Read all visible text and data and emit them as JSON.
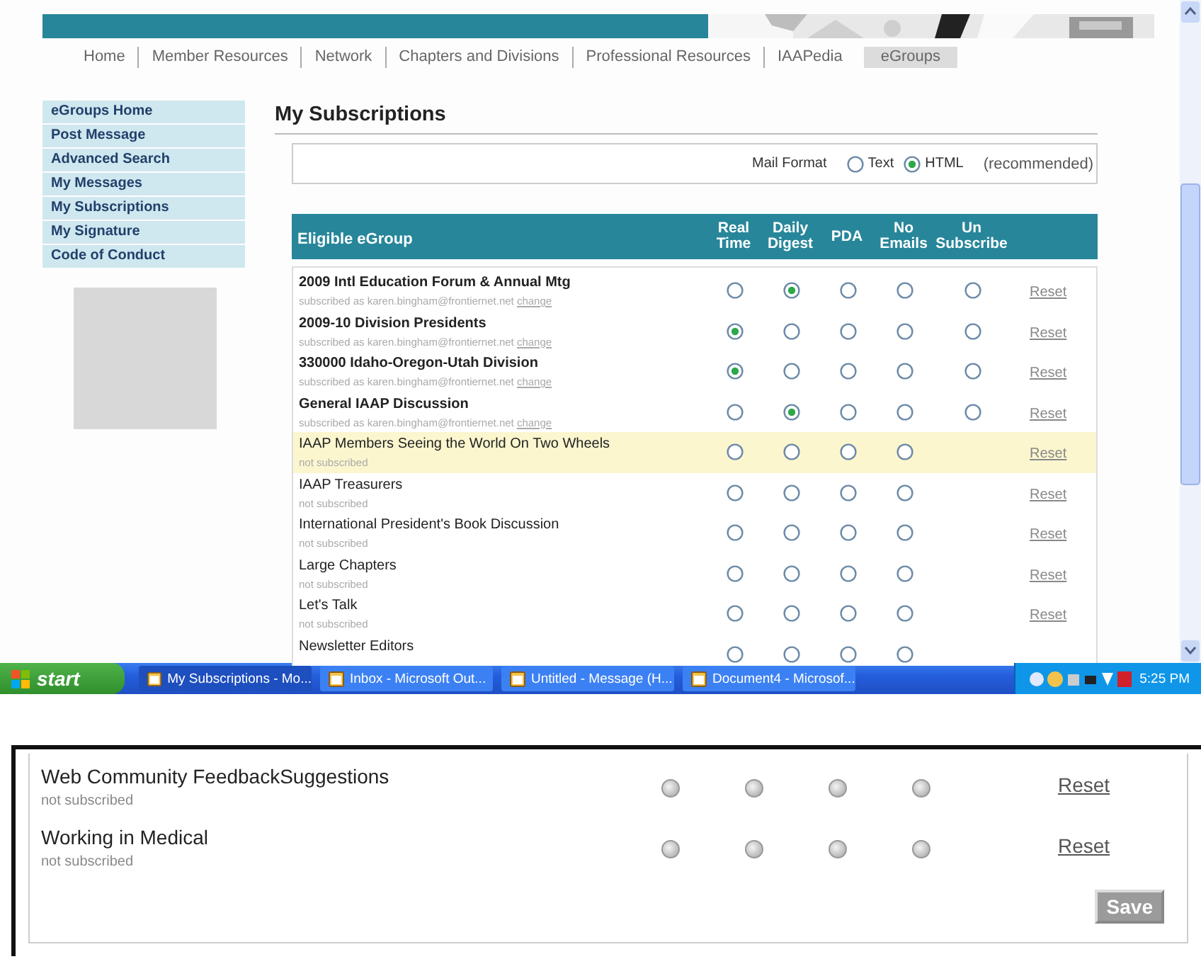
{
  "browser": {
    "nav": [
      {
        "label": "Home",
        "selected": false
      },
      {
        "label": "Member Resources",
        "selected": false
      },
      {
        "label": "Network",
        "selected": false
      },
      {
        "label": "Chapters and Divisions",
        "selected": false
      },
      {
        "label": "Professional Resources",
        "selected": false
      },
      {
        "label": "IAAPedia",
        "selected": false
      },
      {
        "label": "eGroups",
        "selected": true
      }
    ],
    "sidebar": [
      "eGroups Home",
      "Post Message",
      "Advanced Search",
      "My Messages",
      "My Subscriptions",
      "My Signature",
      "Code of Conduct"
    ],
    "title": "My Subscriptions",
    "mail_format": {
      "label": "Mail Format",
      "options": [
        {
          "label": "Text",
          "selected": false
        },
        {
          "label": "HTML",
          "selected": true
        }
      ],
      "note": "(recommended)"
    },
    "columns": [
      "Eligible eGroup",
      "Real Time",
      "Daily Digest",
      "PDA",
      "No Emails",
      "Un Subscribe"
    ],
    "rows": [
      {
        "name": "2009 Intl Education Forum & Annual Mtg",
        "subscribed": true,
        "status": "subscribed as karen.bingham@frontiernet.net",
        "link": "change",
        "highlighted": false,
        "options": [
          {
            "selected": false
          },
          {
            "selected": true
          },
          {
            "selected": false
          },
          {
            "selected": false
          },
          {
            "selected": false
          }
        ],
        "reset": "Reset"
      },
      {
        "name": "2009-10 Division Presidents",
        "subscribed": true,
        "status": "subscribed as karen.bingham@frontiernet.net",
        "link": "change",
        "highlighted": false,
        "options": [
          {
            "selected": true
          },
          {
            "selected": false
          },
          {
            "selected": false
          },
          {
            "selected": false
          },
          {
            "selected": false
          }
        ],
        "reset": "Reset"
      },
      {
        "name": "330000 Idaho-Oregon-Utah Division",
        "subscribed": true,
        "status": "subscribed as karen.bingham@frontiernet.net",
        "link": "change",
        "highlighted": false,
        "options": [
          {
            "selected": true
          },
          {
            "selected": false
          },
          {
            "selected": false
          },
          {
            "selected": false
          },
          {
            "selected": false
          }
        ],
        "reset": "Reset"
      },
      {
        "name": "General IAAP Discussion",
        "subscribed": true,
        "status": "subscribed as karen.bingham@frontiernet.net",
        "link": "change",
        "highlighted": false,
        "options": [
          {
            "selected": false
          },
          {
            "selected": true
          },
          {
            "selected": false
          },
          {
            "selected": false
          },
          {
            "selected": false
          }
        ],
        "reset": "Reset"
      },
      {
        "name": "IAAP Members Seeing the World On Two Wheels",
        "subscribed": false,
        "status": "not subscribed",
        "highlighted": true,
        "options": [
          {
            "selected": false
          },
          {
            "selected": false
          },
          {
            "selected": false
          },
          {
            "selected": false
          }
        ],
        "reset": "Reset"
      },
      {
        "name": "IAAP Treasurers",
        "subscribed": false,
        "status": "not subscribed",
        "highlighted": false,
        "options": [
          {
            "selected": false
          },
          {
            "selected": false
          },
          {
            "selected": false
          },
          {
            "selected": false
          }
        ],
        "reset": "Reset"
      },
      {
        "name": "International President's Book Discussion",
        "subscribed": false,
        "status": "not subscribed",
        "highlighted": false,
        "options": [
          {
            "selected": false
          },
          {
            "selected": false
          },
          {
            "selected": false
          },
          {
            "selected": false
          }
        ],
        "reset": "Reset"
      },
      {
        "name": "Large Chapters",
        "subscribed": false,
        "status": "not subscribed",
        "highlighted": false,
        "options": [
          {
            "selected": false
          },
          {
            "selected": false
          },
          {
            "selected": false
          },
          {
            "selected": false
          }
        ],
        "reset": "Reset"
      },
      {
        "name": "Let's Talk",
        "subscribed": false,
        "status": "not subscribed",
        "highlighted": false,
        "options": [
          {
            "selected": false
          },
          {
            "selected": false
          },
          {
            "selected": false
          },
          {
            "selected": false
          }
        ],
        "reset": "Reset"
      },
      {
        "name": "Newsletter Editors",
        "subscribed": false,
        "highlighted": false,
        "options": [
          {
            "selected": false
          },
          {
            "selected": false
          },
          {
            "selected": false
          },
          {
            "selected": false
          }
        ]
      }
    ]
  },
  "taskbar": {
    "start": "start",
    "tasks": [
      "My Subscriptions - Mo...",
      "Inbox - Microsoft Out...",
      "Untitled - Message (H...",
      "Document4 - Microsof..."
    ],
    "time": "5:25 PM"
  },
  "panel": {
    "rows": [
      {
        "name": "Web Community FeedbackSuggestions",
        "status": "not subscribed",
        "options": [
          {
            "selected": false
          },
          {
            "selected": false
          },
          {
            "selected": false
          },
          {
            "selected": false
          }
        ],
        "reset": "Reset"
      },
      {
        "name": "Working in Medical",
        "status": "not subscribed",
        "options": [
          {
            "selected": false
          },
          {
            "selected": false
          },
          {
            "selected": false
          },
          {
            "selected": false
          }
        ],
        "reset": "Reset"
      }
    ],
    "save": "Save"
  }
}
